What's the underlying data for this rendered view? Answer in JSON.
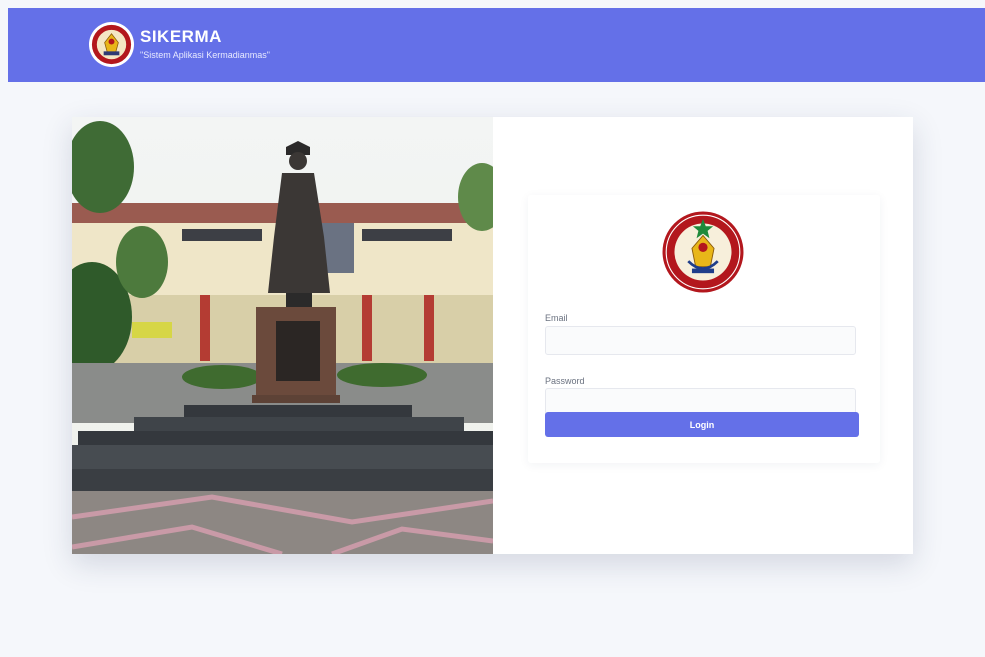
{
  "header": {
    "title": "SIKERMA",
    "subtitle": "\"Sistem Aplikasi Kermadianmas\"",
    "logo_icon": "police-academy-emblem-icon"
  },
  "login_form": {
    "emblem_icon": "sekolah-tinggi-emblem-icon",
    "email_label": "Email",
    "email_value": "",
    "email_placeholder": "",
    "password_label": "Password",
    "password_value": "",
    "password_placeholder": "",
    "submit_label": "Login"
  },
  "colors": {
    "accent": "#6470e8",
    "background": "#f5f7fb",
    "emblem_red": "#b3171d",
    "emblem_gold": "#e8b619"
  }
}
